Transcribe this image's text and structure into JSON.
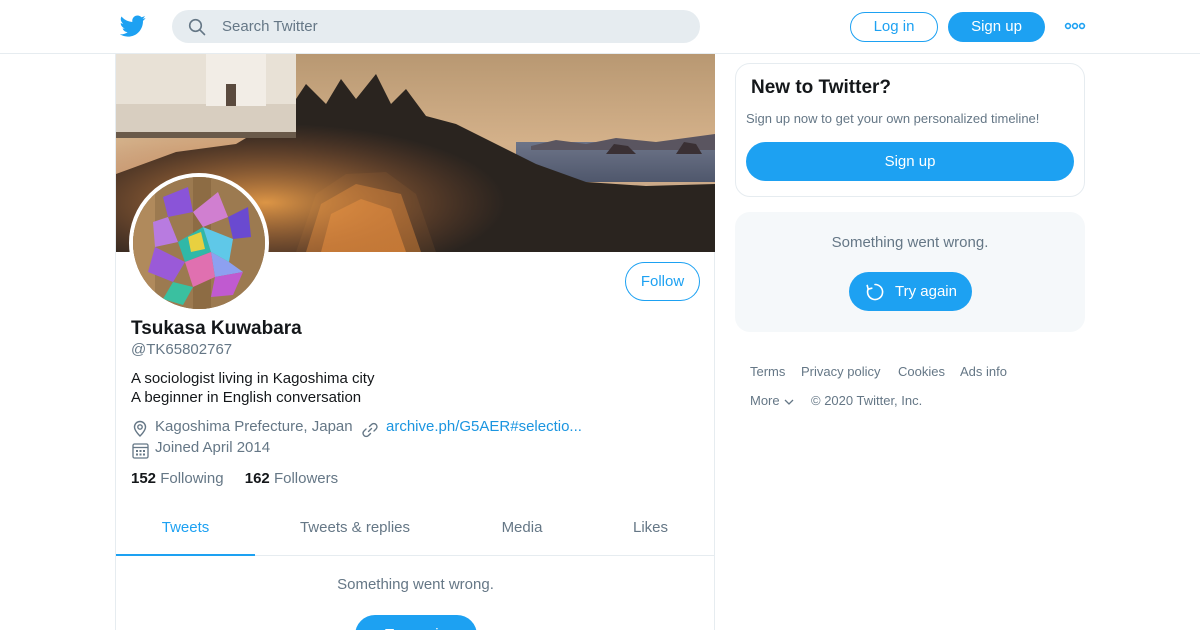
{
  "header": {
    "search_placeholder": "Search Twitter",
    "login_label": "Log in",
    "signup_label": "Sign up"
  },
  "profile": {
    "name": "Tsukasa Kuwabara",
    "handle": "@TK65802767",
    "bio_lines": [
      "A sociologist living in Kagoshima city",
      "A beginner in English conversation"
    ],
    "location": "Kagoshima Prefecture, Japan",
    "url": "archive.ph/G5AER#selectio...",
    "joined": "Joined April 2014",
    "following_count": "152",
    "following_label": "Following",
    "followers_count": "162",
    "followers_label": "Followers",
    "follow_label": "Follow"
  },
  "tabs": [
    {
      "label": "Tweets",
      "active": true
    },
    {
      "label": "Tweets & replies",
      "active": false
    },
    {
      "label": "Media",
      "active": false
    },
    {
      "label": "Likes",
      "active": false
    }
  ],
  "timeline": {
    "error_text": "Something went wrong.",
    "try_again_label": "Try again"
  },
  "sidebar": {
    "new_title": "New to Twitter?",
    "new_subtitle": "Sign up now to get your own personalized timeline!",
    "new_signup_label": "Sign up",
    "error_text": "Something went wrong.",
    "try_again_label": "Try again"
  },
  "footer": {
    "links": [
      "Terms",
      "Privacy policy",
      "Cookies",
      "Ads info",
      "More"
    ],
    "copyright": "© 2020 Twitter, Inc."
  },
  "colors": {
    "accent": "#1da1f2",
    "secondary_text": "#657786",
    "border": "#e6ecf0"
  },
  "icons": [
    "twitter-bird-icon",
    "search-icon",
    "more-dots-icon",
    "location-pin-icon",
    "link-icon",
    "calendar-icon",
    "refresh-icon",
    "chevron-down-icon"
  ]
}
